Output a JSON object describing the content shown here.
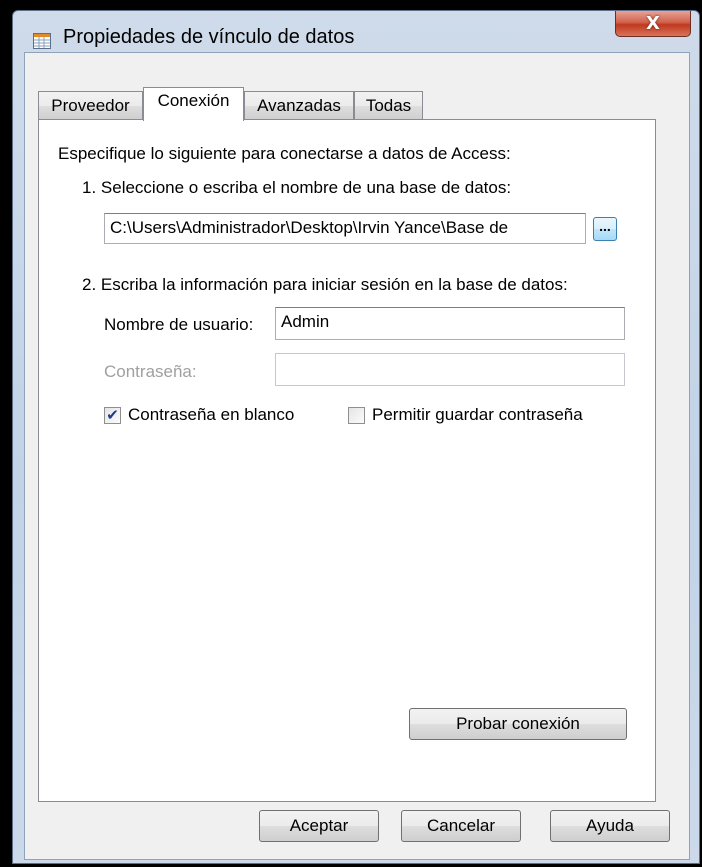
{
  "window": {
    "title": "Propiedades de vínculo de datos",
    "close_label": "X"
  },
  "tabs": [
    {
      "label": "Proveedor",
      "active": false
    },
    {
      "label": "Conexión",
      "active": true
    },
    {
      "label": "Avanzadas",
      "active": false
    },
    {
      "label": "Todas",
      "active": false
    }
  ],
  "connection": {
    "intro": "Especifique lo siguiente para conectarse a datos de Access:",
    "step1_label": "1. Seleccione o escriba el nombre de una base de datos:",
    "database_path": "C:\\Users\\Administrador\\Desktop\\Irvin Yance\\Base de",
    "browse_label": "...",
    "step2_label": "2. Escriba la información para iniciar sesión en la base de datos:",
    "username_label": "Nombre de usuario:",
    "username_value": "Admin",
    "password_label": "Contraseña:",
    "password_value": "",
    "blank_password_label": "Contraseña en blanco",
    "blank_password_checked": true,
    "allow_save_label": "Permitir guardar contraseña",
    "allow_save_checked": false,
    "test_button": "Probar conexión"
  },
  "footer": {
    "ok": "Aceptar",
    "cancel": "Cancelar",
    "help": "Ayuda"
  }
}
